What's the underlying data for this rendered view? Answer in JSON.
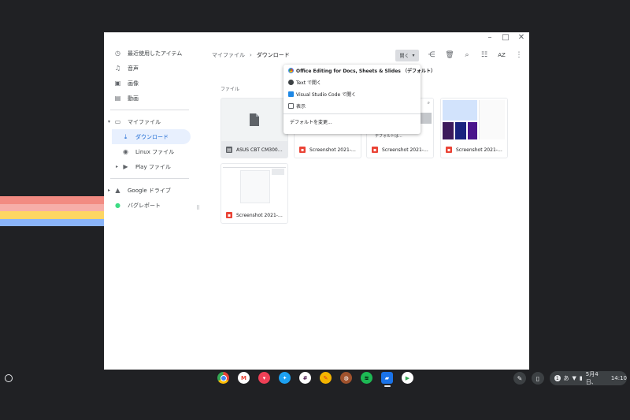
{
  "window": {
    "controls": [
      "minimize-icon",
      "maximize-icon",
      "close-icon"
    ],
    "control_glyphs": [
      "–",
      "□",
      "✕"
    ]
  },
  "sidebar": {
    "items": [
      {
        "label": "最近使用したアイテム",
        "icon": "clock-icon",
        "glyph": "◷"
      },
      {
        "label": "音声",
        "icon": "headphones-icon",
        "glyph": "♫"
      },
      {
        "label": "画像",
        "icon": "image-icon",
        "glyph": "▣"
      },
      {
        "label": "動画",
        "icon": "video-icon",
        "glyph": "▤"
      }
    ],
    "my_files": {
      "label": "マイファイル",
      "icon": "laptop-icon",
      "glyph": "▭",
      "arrow": "▾"
    },
    "downloads": {
      "label": "ダウンロード",
      "icon": "download-icon",
      "glyph": "⤓"
    },
    "linux": {
      "label": "Linux ファイル",
      "icon": "linux-icon",
      "glyph": "◉"
    },
    "play": {
      "label": "Play ファイル",
      "icon": "play-icon",
      "glyph": "▶",
      "arrow": "▸"
    },
    "google_drive": {
      "label": "Google ドライブ",
      "icon": "drive-icon",
      "glyph": "▲",
      "arrow": "▸"
    },
    "bug_report": {
      "label": "バグレポート",
      "icon": "android-icon",
      "glyph": "●"
    }
  },
  "breadcrumb": {
    "parent": "マイファイル",
    "separator": "›",
    "current": "ダウンロード"
  },
  "toolbar": {
    "open_label": "開く",
    "open_arrow": "▾",
    "share_glyph": "⋲",
    "delete_glyph": "🗑",
    "search_glyph": "⌕",
    "grid_glyph": "☷",
    "sort_label": "AZ",
    "more_glyph": "⋮"
  },
  "files_section_label": "ファイル",
  "files": [
    {
      "name": "ASUS CBT CM3000 ...",
      "type": "document"
    },
    {
      "name": "Screenshot 2021-0...",
      "type": "image"
    },
    {
      "name": "Screenshot 2021-0...",
      "type": "image"
    },
    {
      "name": "Screenshot 2021-0...",
      "type": "image"
    },
    {
      "name": "Screenshot 2021-0...",
      "type": "image"
    }
  ],
  "thumb_texts": {
    "partial_caption": "デフォルトは..."
  },
  "open_menu": {
    "items": [
      {
        "label": "Office Editing for Docs, Sheets & Slides （デフォルト）",
        "icon": "chrome-icon",
        "color": "#4285f4"
      },
      {
        "label": "Text で開く",
        "icon": "text-app-icon",
        "color": "#3c4043"
      },
      {
        "label": "Visual Studio Code で開く",
        "icon": "vscode-icon",
        "color": "#1e88e5"
      },
      {
        "label": "表示",
        "icon": "file-icon",
        "color": "#5f6368"
      }
    ],
    "change_default": "デフォルトを変更..."
  },
  "shelf": {
    "apps": [
      {
        "name": "chrome-icon",
        "color": "#fbbc05",
        "glyph": "◉"
      },
      {
        "name": "gmail-icon",
        "color": "#ffffff",
        "glyph": "M"
      },
      {
        "name": "pocket-icon",
        "color": "#ef4056",
        "glyph": "▾"
      },
      {
        "name": "twitter-icon",
        "color": "#1da1f2",
        "glyph": "✦"
      },
      {
        "name": "slack-icon",
        "color": "#4a154b",
        "glyph": "#"
      },
      {
        "name": "keep-icon",
        "color": "#f4b400",
        "glyph": "✎"
      },
      {
        "name": "photo-app-icon",
        "color": "#a0522d",
        "glyph": "◍"
      },
      {
        "name": "spotify-icon",
        "color": "#1db954",
        "glyph": "≋"
      },
      {
        "name": "files-icon",
        "color": "#1a73e8",
        "glyph": "▰"
      },
      {
        "name": "play-store-icon",
        "color": "#34a853",
        "glyph": "▶"
      }
    ],
    "stylus_glyph": "✎",
    "phone_glyph": "▯",
    "status": {
      "notification": "1",
      "ime": "あ",
      "wifi_glyph": "▼",
      "battery_glyph": "▮",
      "date": "5月4日、",
      "time": "14:10"
    }
  },
  "colors": {
    "accent": "#1967d2",
    "selected_bg": "#e8f0fe",
    "wallpaper": "#202124",
    "stripes": [
      "#f28b82",
      "#f6aea9",
      "#fdd663",
      "#a8dab5",
      "#8ab4f8"
    ],
    "image_file_icon": "#ea4335"
  }
}
